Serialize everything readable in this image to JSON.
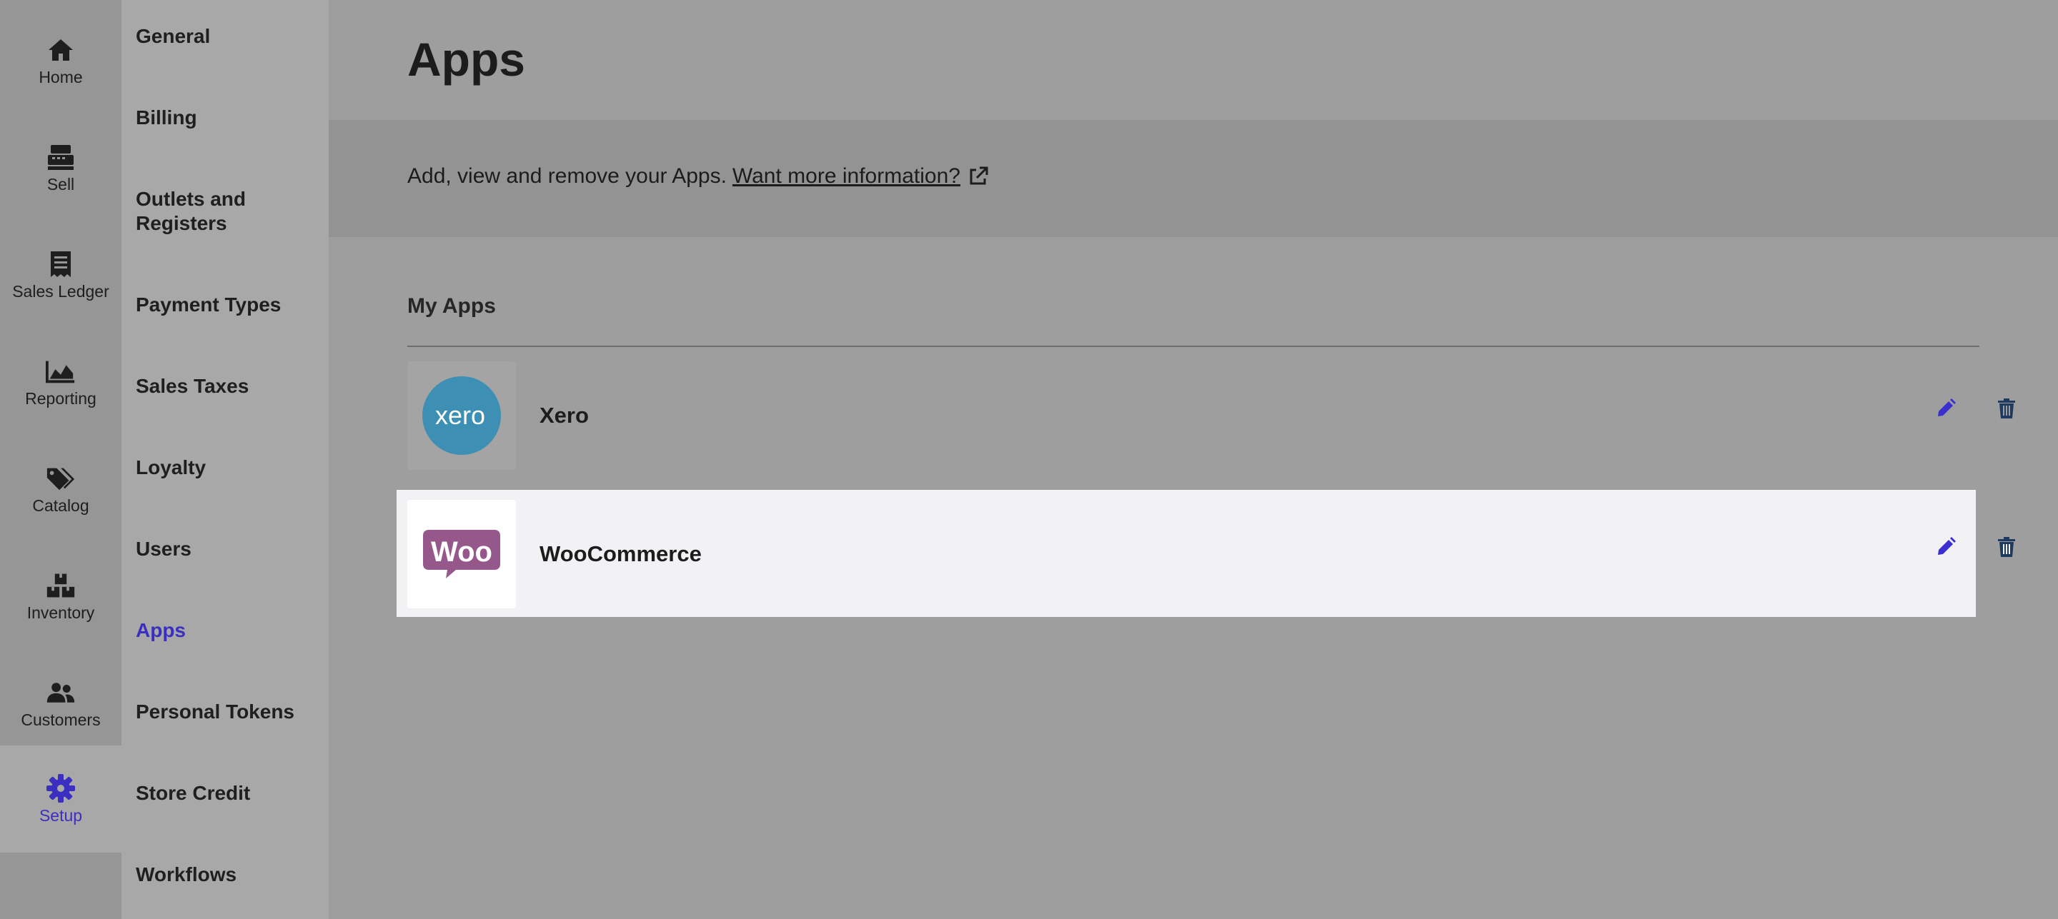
{
  "rail": {
    "items": [
      {
        "label": "Home",
        "icon": "home-icon"
      },
      {
        "label": "Sell",
        "icon": "register-icon"
      },
      {
        "label": "Sales Ledger",
        "icon": "receipt-icon"
      },
      {
        "label": "Reporting",
        "icon": "area-chart-icon"
      },
      {
        "label": "Catalog",
        "icon": "tags-icon"
      },
      {
        "label": "Inventory",
        "icon": "boxes-icon"
      },
      {
        "label": "Customers",
        "icon": "users-icon"
      },
      {
        "label": "Setup",
        "icon": "gear-icon",
        "active": true
      }
    ]
  },
  "subnav": {
    "items": [
      {
        "label": "General"
      },
      {
        "label": "Billing"
      },
      {
        "label": "Outlets and Registers"
      },
      {
        "label": "Payment Types"
      },
      {
        "label": "Sales Taxes"
      },
      {
        "label": "Loyalty"
      },
      {
        "label": "Users"
      },
      {
        "label": "Apps",
        "active": true
      },
      {
        "label": "Personal Tokens"
      },
      {
        "label": "Store Credit"
      },
      {
        "label": "Workflows"
      }
    ]
  },
  "main": {
    "title": "Apps",
    "info_text": "Add, view and remove your Apps.",
    "info_link": "Want more information?",
    "section_title": "My Apps",
    "apps": [
      {
        "name": "Xero",
        "logo_text": "xero"
      },
      {
        "name": "WooCommerce",
        "logo_text": "Woo"
      }
    ]
  },
  "colors": {
    "accent": "#3a2fc0",
    "edit_icon": "#3b2fd0",
    "delete_icon": "#1e3a5f",
    "xero_brand": "#3d8fb3",
    "woo_brand": "#96588a"
  }
}
